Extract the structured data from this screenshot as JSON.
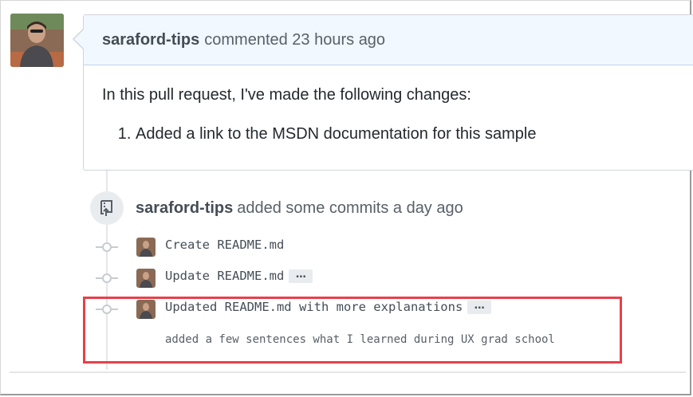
{
  "comment": {
    "author": "saraford-tips",
    "action": "commented 23 hours ago",
    "body_intro": "In this pull request, I've made the following changes:",
    "body_items": [
      "Added a link to the MSDN documentation for this sample"
    ]
  },
  "push_event": {
    "author": "saraford-tips",
    "action": "added some commits a day ago"
  },
  "commits": [
    {
      "message": "Create README.md",
      "has_ellipsis": false
    },
    {
      "message": "Update README.md",
      "has_ellipsis": true,
      "ellipsis_label": "…"
    },
    {
      "message": "Updated README.md with more explanations",
      "has_ellipsis": true,
      "ellipsis_label": "…",
      "description": "added a few sentences what I learned during UX grad school"
    }
  ],
  "colors": {
    "highlight": "#e8404a",
    "header_bg": "#f1f8ff",
    "border": "#d1d5da"
  }
}
